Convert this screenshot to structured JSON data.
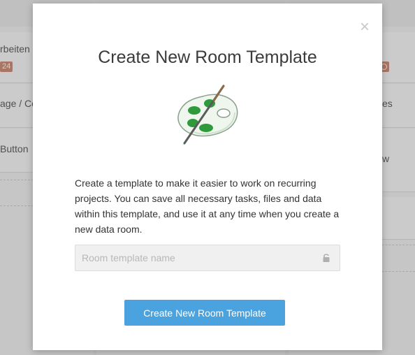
{
  "background": {
    "cards": [
      {
        "text": "rbeiten",
        "badge": "24"
      },
      {
        "text": "age / Co"
      },
      {
        "text": "Button"
      },
      {
        "text": "es"
      },
      {
        "text": "w"
      }
    ]
  },
  "modal": {
    "close_icon": "×",
    "title": "Create New Room Template",
    "illustration": "palette-brush-icon",
    "description": "Create a template to make it easier to work on recurring projects. You can save all necessary tasks, files and data within this template, and use it at any time when you create a new data room.",
    "input": {
      "placeholder": "Room template name",
      "value": "",
      "icon": "lock-icon"
    },
    "submit_label": "Create New Room Template"
  },
  "colors": {
    "accent": "#4aa3df",
    "badge": "#c7745a",
    "palette_green": "#2e9a3c"
  }
}
